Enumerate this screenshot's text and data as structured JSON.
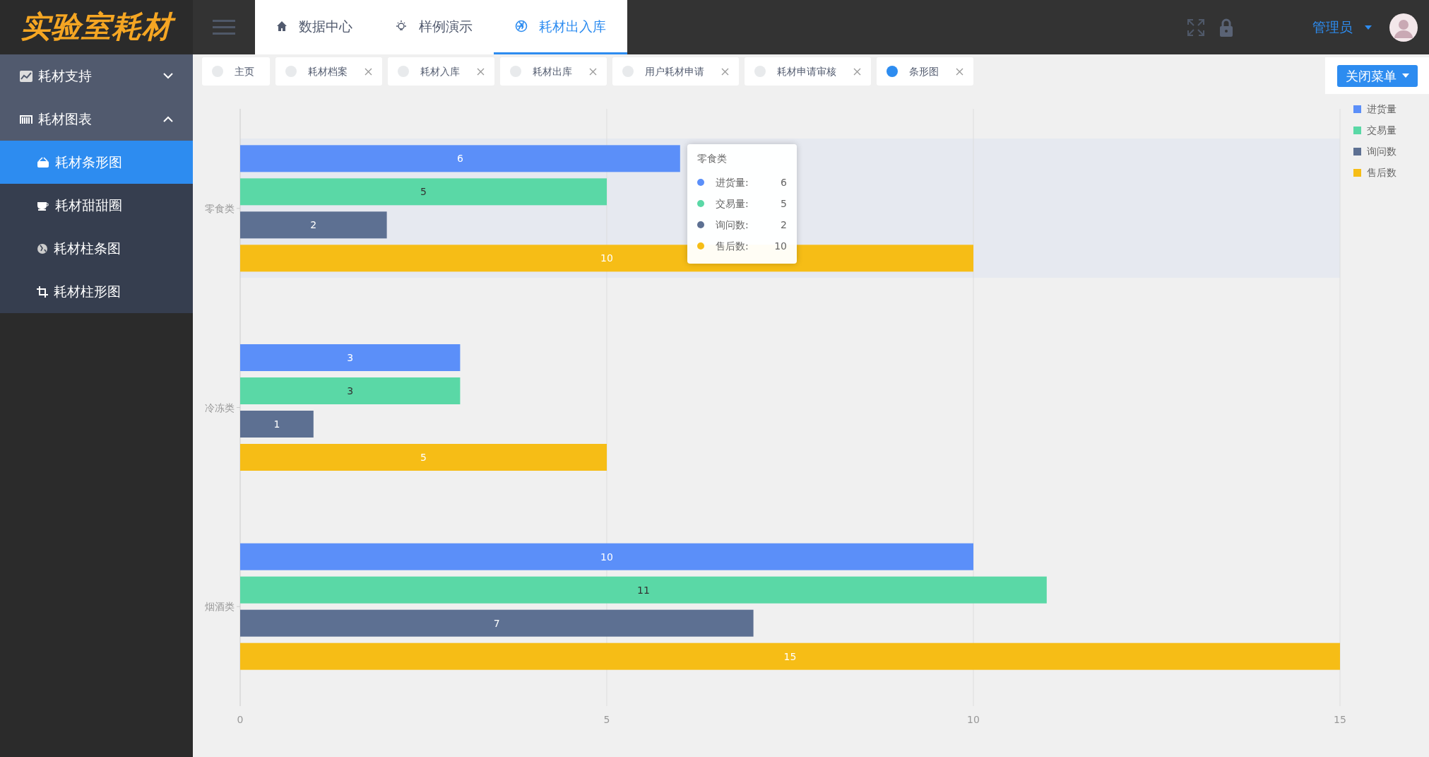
{
  "logo": "实验室耗材",
  "top_nav": [
    {
      "label": "数据中心",
      "selected": false
    },
    {
      "label": "样例演示",
      "selected": false
    },
    {
      "label": "耗材出入库",
      "selected": true
    }
  ],
  "user": "管理员",
  "sidebar": [
    {
      "label": "耗材支持",
      "expanded": false
    },
    {
      "label": "耗材图表",
      "expanded": true,
      "children": [
        {
          "label": "耗材条形图",
          "selected": true
        },
        {
          "label": "耗材甜甜圈",
          "selected": false
        },
        {
          "label": "耗材柱条图",
          "selected": false
        },
        {
          "label": "耗材柱形图",
          "selected": false
        }
      ]
    }
  ],
  "tabs": [
    {
      "label": "主页",
      "selected": false,
      "closable": false
    },
    {
      "label": "耗材档案",
      "selected": false,
      "closable": true
    },
    {
      "label": "耗材入库",
      "selected": false,
      "closable": true
    },
    {
      "label": "耗材出库",
      "selected": false,
      "closable": true
    },
    {
      "label": "用户耗材申请",
      "selected": false,
      "closable": true
    },
    {
      "label": "耗材申请审核",
      "selected": false,
      "closable": true
    },
    {
      "label": "条形图",
      "selected": true,
      "closable": true
    }
  ],
  "close_menu": "关闭菜单",
  "chart_data": {
    "type": "bar",
    "orientation": "horizontal",
    "categories": [
      "零食类",
      "冷冻类",
      "烟酒类"
    ],
    "series": [
      {
        "name": "进货量",
        "color": "#5b8ff9",
        "values": [
          6,
          3,
          10
        ]
      },
      {
        "name": "交易量",
        "color": "#5ad8a6",
        "values": [
          5,
          3,
          11
        ]
      },
      {
        "name": "询问数",
        "color": "#5d7092",
        "values": [
          2,
          1,
          7
        ]
      },
      {
        "name": "售后数",
        "color": "#f6bd16",
        "values": [
          10,
          5,
          15
        ]
      }
    ],
    "xlim": [
      0,
      15
    ],
    "xticks": [
      0,
      5,
      10,
      15
    ],
    "data_labels": true,
    "legend": "upper right"
  },
  "tooltip": {
    "title": "零食类",
    "rows": [
      {
        "name": "进货量:",
        "value": "6",
        "color": "#5b8ff9"
      },
      {
        "name": "交易量:",
        "value": "5",
        "color": "#5ad8a6"
      },
      {
        "name": "询问数:",
        "value": "2",
        "color": "#5d7092"
      },
      {
        "name": "售后数:",
        "value": "10",
        "color": "#f6bd16"
      }
    ]
  }
}
